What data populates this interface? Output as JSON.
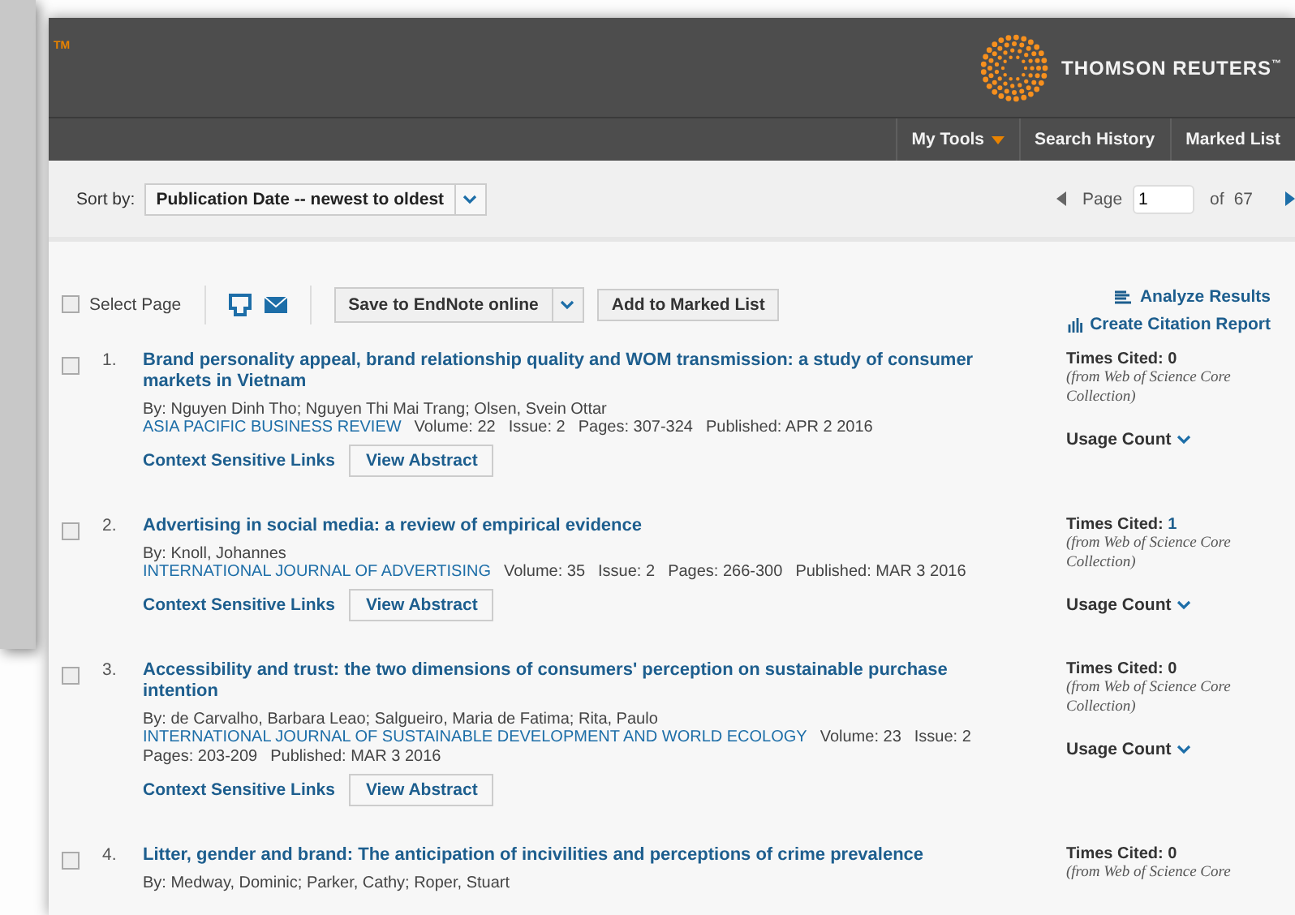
{
  "header": {
    "trademark": "TM",
    "brand": "THOMSON REUTERS",
    "brand_mark": "™"
  },
  "nav": [
    {
      "label": "My Tools",
      "dropdown": true
    },
    {
      "label": "Search History",
      "dropdown": false
    },
    {
      "label": "Marked List",
      "dropdown": false
    }
  ],
  "sort": {
    "label": "Sort by:",
    "value": "Publication Date -- newest to oldest"
  },
  "pager": {
    "label": "Page",
    "value": "1",
    "of": "of",
    "total": "67"
  },
  "toolbar": {
    "select_page": {
      "label": "Select Page",
      "checked": false
    },
    "save_button": "Save to EndNote online",
    "marked_button": "Add to Marked List",
    "analyze": "Analyze Results",
    "citation_report": "Create Citation Report"
  },
  "records": [
    {
      "number": "1.",
      "checked": false,
      "title": "Brand personality appeal, brand relationship quality and WOM transmission: a study of consumer markets in Vietnam",
      "authors": "By: Nguyen Dinh Tho; Nguyen Thi Mai Trang; Olsen, Svein Ottar",
      "journal": "ASIA PACIFIC BUSINESS REVIEW",
      "details": [
        "Volume: 22",
        "Issue: 2",
        "Pages: 307-324",
        "Published: APR 2 2016"
      ],
      "links": "Context Sensitive Links",
      "abstract": "View Abstract",
      "cited_label": "Times Cited:",
      "cited": "0",
      "cited_linked": false,
      "note": [
        "(from Web of Science Core",
        "Collection)"
      ],
      "usage": "Usage Count"
    },
    {
      "number": "2.",
      "checked": false,
      "title": "Advertising in social media: a review of empirical evidence",
      "authors": "By: Knoll, Johannes",
      "journal": "INTERNATIONAL JOURNAL OF ADVERTISING",
      "details": [
        "Volume: 35",
        "Issue: 2",
        "Pages: 266-300",
        "Published: MAR 3 2016"
      ],
      "links": "Context Sensitive Links",
      "abstract": "View Abstract",
      "cited_label": "Times Cited:",
      "cited": "1",
      "cited_linked": true,
      "note": [
        "(from Web of Science Core",
        "Collection)"
      ],
      "usage": "Usage Count"
    },
    {
      "number": "3.",
      "checked": false,
      "title": "Accessibility and trust: the two dimensions of consumers' perception on sustainable purchase intention",
      "authors": "By: de Carvalho, Barbara Leao; Salgueiro, Maria de Fatima; Rita, Paulo",
      "journal": "INTERNATIONAL JOURNAL OF SUSTAINABLE DEVELOPMENT AND WORLD ECOLOGY",
      "details": [
        "Volume: 23",
        "Issue: 2",
        "Pages: 203-209",
        "Published: MAR 3 2016"
      ],
      "links": "Context Sensitive Links",
      "abstract": "View Abstract",
      "cited_label": "Times Cited:",
      "cited": "0",
      "cited_linked": false,
      "note": [
        "(from Web of Science Core",
        "Collection)"
      ],
      "usage": "Usage Count"
    },
    {
      "number": "4.",
      "checked": false,
      "title": "Litter, gender and brand: The anticipation of incivilities and perceptions of crime prevalence",
      "authors": "By: Medway, Dominic; Parker, Cathy; Roper, Stuart",
      "cited_label": "Times Cited:",
      "cited": "0",
      "cited_linked": false,
      "note": [
        "(from Web of Science Core"
      ]
    }
  ]
}
